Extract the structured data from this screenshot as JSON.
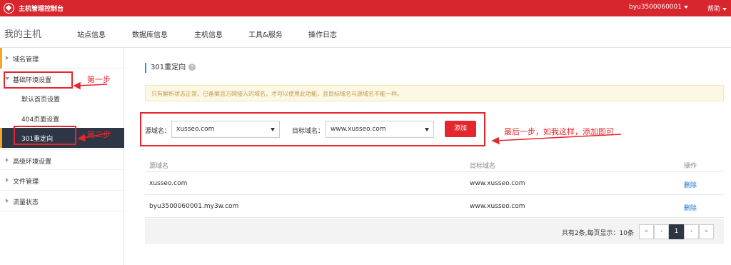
{
  "topbar": {
    "title": "主机管理控制台",
    "user": "byu3500060001",
    "help": "帮助"
  },
  "navbar": {
    "brand": "我的主机",
    "items": [
      "站点信息",
      "数据库信息",
      "主机信息",
      "工具&服务",
      "操作日志"
    ]
  },
  "sidebar": {
    "domain_mgmt": "域名管理",
    "basic_env": "基础环境设置",
    "sub": [
      "默认首页设置",
      "404页面设置",
      "301重定向"
    ],
    "advanced_env": "高级环境设置",
    "file_mgmt": "文件管理",
    "traffic": "流量状态"
  },
  "main": {
    "title": "301重定向",
    "help_icon": "?",
    "notice": "只有解析状态正常、已备案且万网接入的域名，才可以使用此功能，且目标域名与源域名不能一样。",
    "form": {
      "source_label": "源域名：",
      "source_value": "xusseo.com",
      "target_label": "目标域名：",
      "target_value": "www.xusseo.com",
      "add_button": "添加"
    },
    "table": {
      "headers": [
        "源域名",
        "目标域名",
        "操作"
      ],
      "rows": [
        {
          "source": "xusseo.com",
          "target": "www.xusseo.com",
          "action": "删除"
        },
        {
          "source": "byu3500060001.my3w.com",
          "target": "www.xusseo.com",
          "action": "删除"
        }
      ]
    },
    "pager": {
      "info": "共有2条,每页显示：10条",
      "first": "«",
      "prev": "‹",
      "current": "1",
      "next": "›",
      "last": "»"
    }
  },
  "annotations": {
    "step1": "第一步",
    "step2": "第二步",
    "step3": "最后一步，如我这样，添加即可"
  },
  "colors": {
    "topbar": "#d8262e",
    "accent": "#e5262d",
    "sidebar_active": "#2e3645",
    "link": "#1a6fd1"
  }
}
